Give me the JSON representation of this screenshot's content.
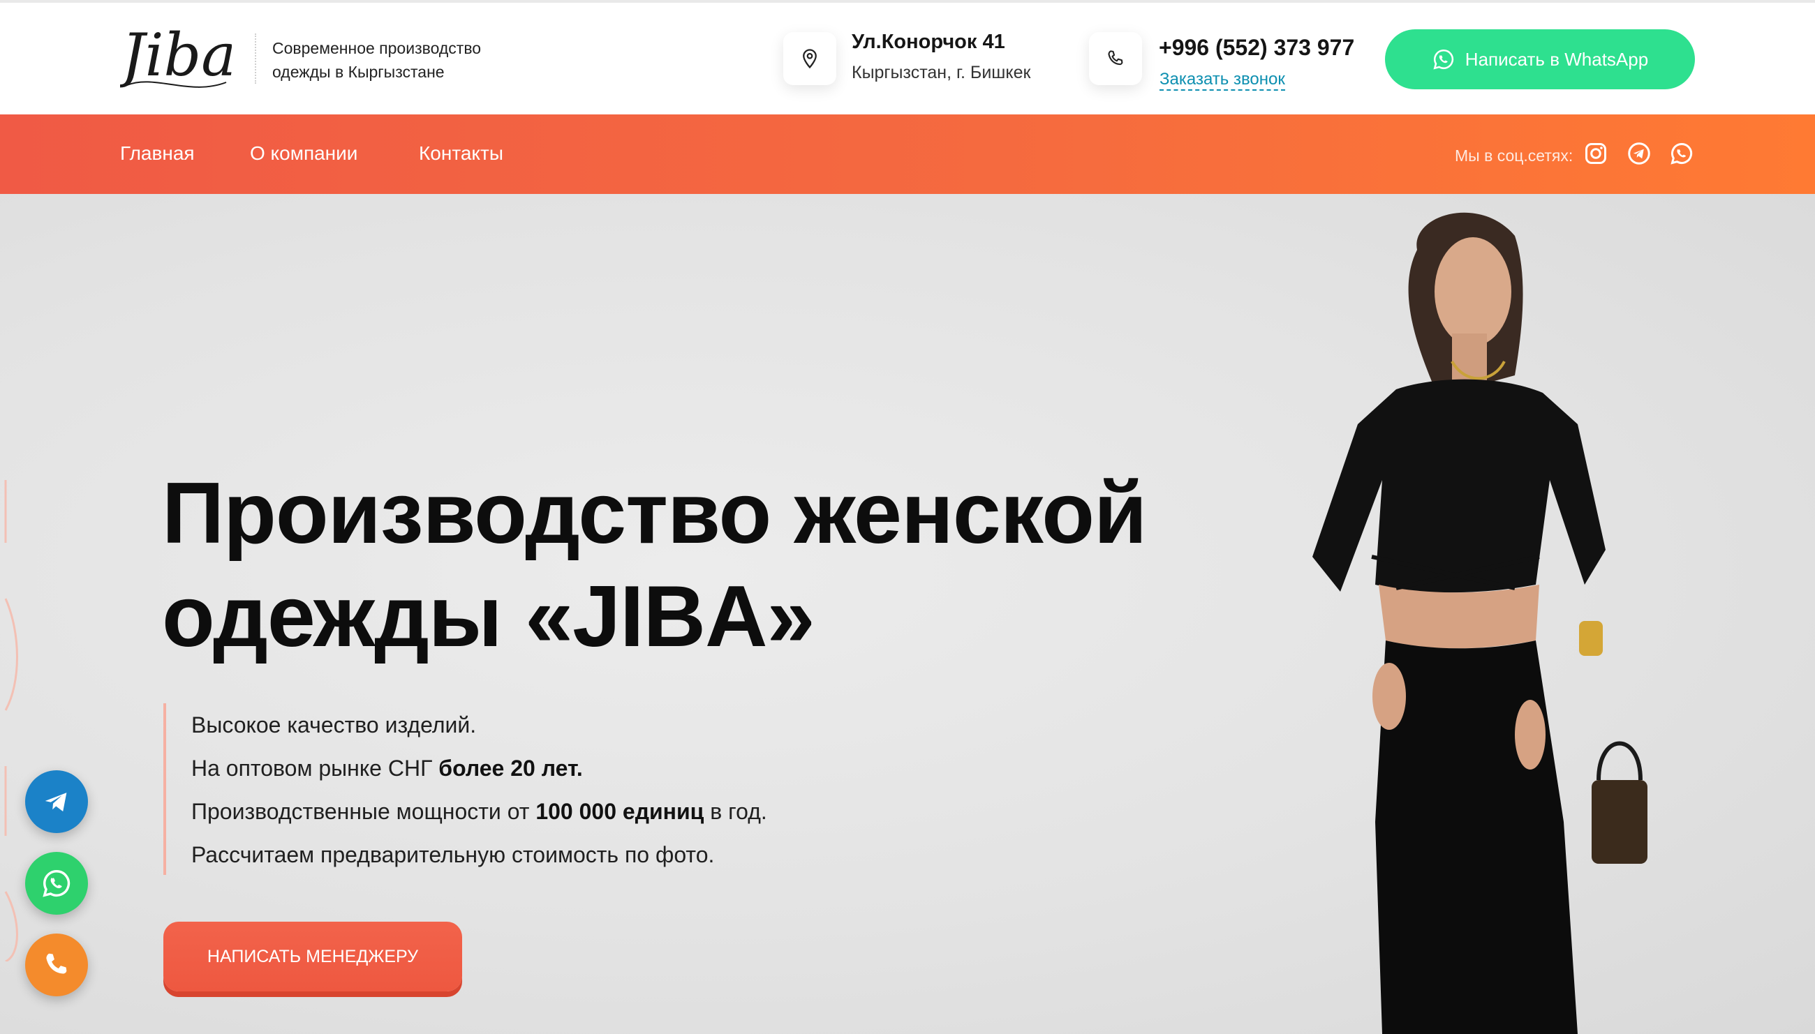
{
  "header": {
    "logo_text": "Jiba",
    "tagline_line1": "Современное производство",
    "tagline_line2": "одежды в Кыргызстане",
    "address_title": "Ул.Конорчок 41",
    "address_sub": "Кыргызстан, г. Бишкек",
    "phone": "+996 (552) 373 977",
    "callback_link": "Заказать звонок",
    "whatsapp_button": "Написать в WhatsApp"
  },
  "nav": {
    "items": [
      {
        "label": "Главная"
      },
      {
        "label": "О компании"
      },
      {
        "label": "Контакты"
      }
    ],
    "social_label": "Мы в соц.сетях:"
  },
  "hero": {
    "title_line1": "Производство женской",
    "title_line2": "одежды «JIBA»",
    "features": [
      {
        "text": "Высокое качество изделий."
      },
      {
        "pre": "На оптовом рынке СНГ ",
        "bold": "более 20 лет."
      },
      {
        "pre": "Производственные мощности от ",
        "bold": "100 000 единиц",
        "post": " в год."
      },
      {
        "text": "Рассчитаем предварительную стоимость по фото."
      }
    ],
    "cta_button": "НАПИСАТЬ МЕНЕДЖЕРУ"
  },
  "colors": {
    "accent": "#f05a45",
    "accent_end": "#ff7a33",
    "whatsapp": "#2ee08f",
    "telegram": "#1b82c8",
    "phone": "#f48b2c",
    "link": "#0d8fb0"
  },
  "icons": [
    "location-pin-icon",
    "phone-icon",
    "whatsapp-icon",
    "instagram-icon",
    "telegram-icon"
  ]
}
